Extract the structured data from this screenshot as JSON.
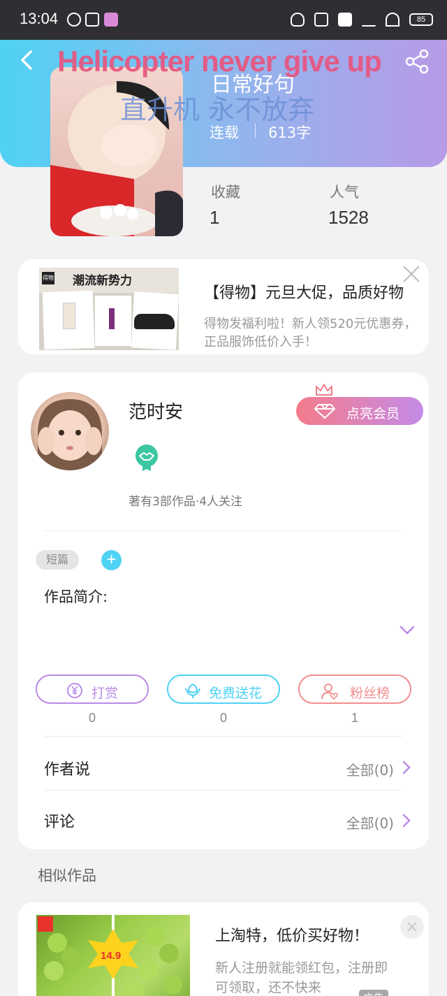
{
  "status_bar": {
    "time": "13:04",
    "battery": "85"
  },
  "header": {
    "watermark_en": "Helicopter never give up",
    "watermark_cn": "直升机 永不放弃",
    "book_title": "日常好句",
    "book_status": "连载",
    "word_count": "613字"
  },
  "stats": [
    {
      "label": "收藏",
      "value": "1"
    },
    {
      "label": "人气",
      "value": "1528"
    }
  ],
  "ad_top": {
    "image_brand": "得物",
    "image_headline": "潮流新势力",
    "title": "【得物】元旦大促，品质好物",
    "description": "得物发福利啦！新人领520元优惠券，正品服饰低价入手！"
  },
  "author": {
    "name": "范时安",
    "vip_label": "点亮会员",
    "meta": "著有3部作品·4人关注"
  },
  "work": {
    "tag": "短篇",
    "intro_label": "作品简介:"
  },
  "actions": [
    {
      "label": "打赏",
      "count": "0",
      "color": "#b98be6"
    },
    {
      "label": "免费送花",
      "count": "0",
      "color": "#4fd2f4"
    },
    {
      "label": "粉丝榜",
      "count": "1",
      "color": "#ef8e8e"
    }
  ],
  "rows": {
    "author_says": {
      "label": "作者说",
      "all": "全部(0)"
    },
    "comments": {
      "label": "评论",
      "all": "全部(0)"
    }
  },
  "similar": {
    "title": "相似作品"
  },
  "ad_bottom": {
    "image_price": "14.9",
    "title": "上淘特，低价买好物！",
    "description": "新人注册就能领红包，注册即可领取，还不快来",
    "ad_label": "广告"
  },
  "colors": {
    "accent_cyan": "#4fd2f4",
    "accent_purple": "#b98be6",
    "accent_red": "#ef8e8e"
  }
}
